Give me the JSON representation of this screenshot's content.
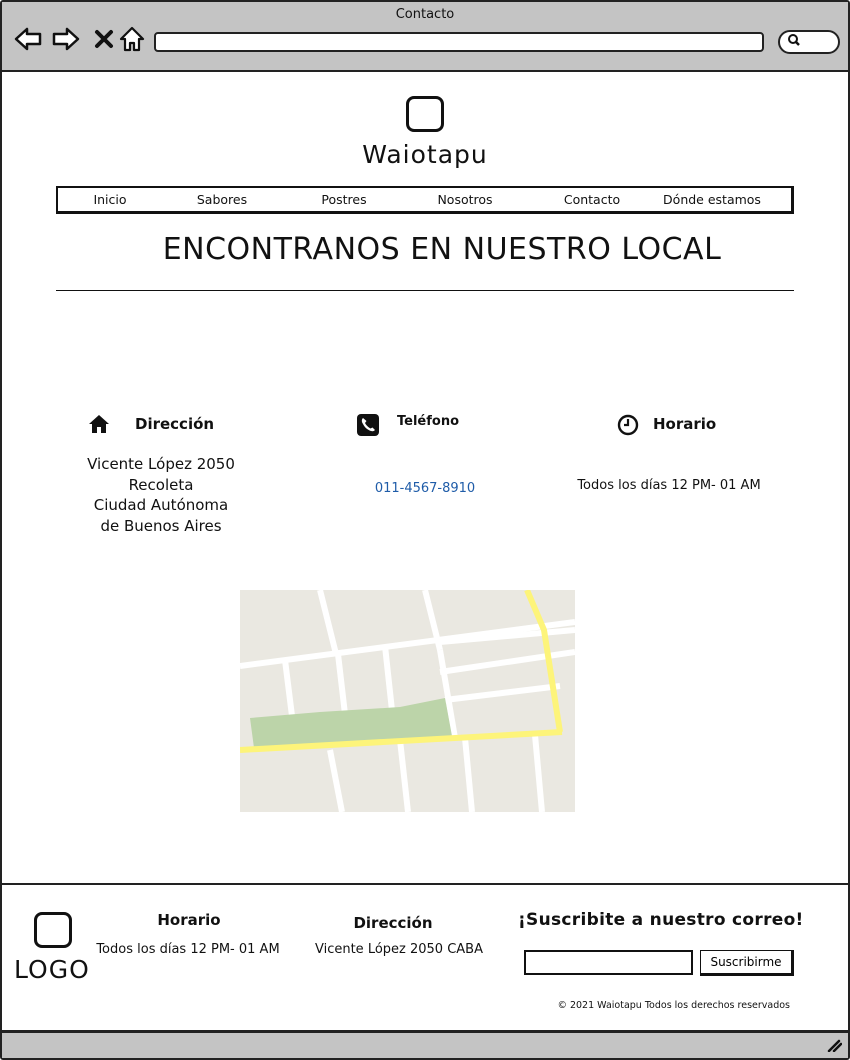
{
  "window": {
    "title": "Contacto"
  },
  "browser": {
    "back_icon": "arrow-left-icon",
    "forward_icon": "arrow-right-icon",
    "close_icon": "x-icon",
    "home_icon": "home-icon",
    "url": "",
    "search_icon": "search-icon"
  },
  "header": {
    "brand": "Waiotapu",
    "menu": [
      "Inicio",
      "Sabores",
      "Postres",
      "Nosotros",
      "Contacto",
      "Dónde estamos"
    ]
  },
  "main": {
    "title": "ENCONTRANOS EN NUESTRO LOCAL",
    "address": {
      "label": "Dirección",
      "icon": "home-icon",
      "lines": [
        "Vicente López 2050",
        "Recoleta",
        "Ciudad Autónoma",
        "de Buenos Aires"
      ]
    },
    "phone": {
      "label": "Teléfono",
      "icon": "phone-icon",
      "number": "011-4567-8910"
    },
    "hours": {
      "label": "Horario",
      "icon": "clock-icon",
      "text": "Todos los días 12 PM- 01 AM"
    }
  },
  "colors": {
    "chrome": "#c4c4c4",
    "link": "#1f5ca8",
    "map_bg": "#eae8e1",
    "map_road_major": "#fdf47a",
    "map_park": "#bcd4a9"
  },
  "footer": {
    "logo": "LOGO",
    "hours_label": "Horario",
    "hours_text": "Todos los días 12 PM- 01 AM",
    "address_label": "Dirección",
    "address_text": "Vicente López 2050 CABA",
    "subscribe_title": "¡Suscribite a nuestro correo!",
    "email_value": "",
    "subscribe_button": "Suscribirme",
    "copyright": "© 2021 Waiotapu Todos los derechos reservados"
  }
}
